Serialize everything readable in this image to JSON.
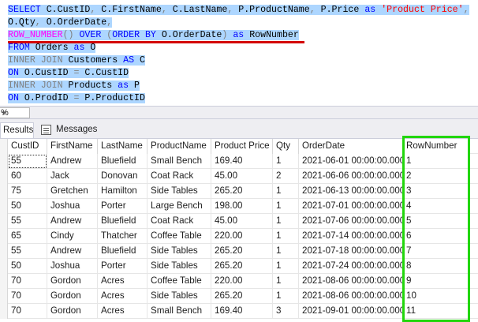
{
  "editor": {
    "lines": [
      {
        "segments": [
          {
            "t": "SELECT",
            "c": "kw"
          },
          {
            "t": " C.CustID",
            "c": "id"
          },
          {
            "t": ",",
            "c": "op"
          },
          {
            "t": " C.FirstName",
            "c": "id"
          },
          {
            "t": ",",
            "c": "op"
          },
          {
            "t": " C.LastName",
            "c": "id"
          },
          {
            "t": ",",
            "c": "op"
          },
          {
            "t": " P.ProductName",
            "c": "id"
          },
          {
            "t": ",",
            "c": "op"
          },
          {
            "t": " P.Price ",
            "c": "id"
          },
          {
            "t": "as",
            "c": "kw"
          },
          {
            "t": " ",
            "c": "id"
          },
          {
            "t": "'Product Price'",
            "c": "str"
          },
          {
            "t": ",",
            "c": "op"
          }
        ]
      },
      {
        "segments": [
          {
            "t": "O.Qty",
            "c": "id"
          },
          {
            "t": ",",
            "c": "op"
          },
          {
            "t": " O.OrderDate",
            "c": "id"
          },
          {
            "t": ",",
            "c": "op"
          }
        ]
      },
      {
        "segments": [
          {
            "t": "ROW_NUMBER",
            "c": "fn"
          },
          {
            "t": "() ",
            "c": "op"
          },
          {
            "t": "OVER",
            "c": "kw"
          },
          {
            "t": " ",
            "c": "id"
          },
          {
            "t": "(",
            "c": "op"
          },
          {
            "t": "ORDER BY",
            "c": "kw"
          },
          {
            "t": " O.OrderDate",
            "c": "id"
          },
          {
            "t": ")",
            "c": "op"
          },
          {
            "t": " ",
            "c": "id"
          },
          {
            "t": "as",
            "c": "kw"
          },
          {
            "t": " RowNumber",
            "c": "id"
          }
        ]
      },
      {
        "segments": [
          {
            "t": "FROM",
            "c": "kw"
          },
          {
            "t": " Orders ",
            "c": "id"
          },
          {
            "t": "as",
            "c": "kw"
          },
          {
            "t": " O",
            "c": "id"
          }
        ]
      },
      {
        "segments": [
          {
            "t": "INNER JOIN",
            "c": "op"
          },
          {
            "t": " Customers ",
            "c": "id"
          },
          {
            "t": "AS",
            "c": "kw"
          },
          {
            "t": " C",
            "c": "id"
          }
        ]
      },
      {
        "segments": [
          {
            "t": "ON",
            "c": "kw"
          },
          {
            "t": " O.CustID ",
            "c": "id"
          },
          {
            "t": "=",
            "c": "op"
          },
          {
            "t": " C.CustID",
            "c": "id"
          }
        ]
      },
      {
        "segments": [
          {
            "t": "INNER JOIN",
            "c": "op"
          },
          {
            "t": " Products ",
            "c": "id"
          },
          {
            "t": "as",
            "c": "kw"
          },
          {
            "t": " P",
            "c": "id"
          }
        ]
      },
      {
        "segments": [
          {
            "t": "ON",
            "c": "kw"
          },
          {
            "t": " O.ProdID ",
            "c": "id"
          },
          {
            "t": "=",
            "c": "op"
          },
          {
            "t": " P.ProductID",
            "c": "id"
          }
        ]
      }
    ]
  },
  "zoom": {
    "value": "%"
  },
  "tabs": {
    "results": "Results",
    "messages": "Messages"
  },
  "grid": {
    "columns": [
      "CustID",
      "FirstName",
      "LastName",
      "ProductName",
      "Product Price",
      "Qty",
      "OrderDate",
      "RowNumber"
    ],
    "rows": [
      [
        "55",
        "Andrew",
        "Bluefield",
        "Small Bench",
        "169.40",
        "1",
        "2021-06-01 00:00:00.000",
        "1"
      ],
      [
        "60",
        "Jack",
        "Donovan",
        "Coat Rack",
        "45.00",
        "2",
        "2021-06-06 00:00:00.000",
        "2"
      ],
      [
        "75",
        "Gretchen",
        "Hamilton",
        "Side Tables",
        "265.20",
        "1",
        "2021-06-13 00:00:00.000",
        "3"
      ],
      [
        "50",
        "Joshua",
        "Porter",
        "Large Bench",
        "198.00",
        "1",
        "2021-07-01 00:00:00.000",
        "4"
      ],
      [
        "55",
        "Andrew",
        "Bluefield",
        "Coat Rack",
        "45.00",
        "1",
        "2021-07-06 00:00:00.000",
        "5"
      ],
      [
        "65",
        "Cindy",
        "Thatcher",
        "Coffee Table",
        "220.00",
        "1",
        "2021-07-14 00:00:00.000",
        "6"
      ],
      [
        "55",
        "Andrew",
        "Bluefield",
        "Side Tables",
        "265.20",
        "1",
        "2021-07-18 00:00:00.000",
        "7"
      ],
      [
        "50",
        "Joshua",
        "Porter",
        "Side Tables",
        "265.20",
        "1",
        "2021-07-24 00:00:00.000",
        "8"
      ],
      [
        "70",
        "Gordon",
        "Acres",
        "Coffee Table",
        "220.00",
        "1",
        "2021-08-06 00:00:00.000",
        "9"
      ],
      [
        "70",
        "Gordon",
        "Acres",
        "Side Tables",
        "265.20",
        "1",
        "2021-08-06 00:00:00.000",
        "10"
      ],
      [
        "70",
        "Gordon",
        "Acres",
        "Small Bench",
        "169.40",
        "3",
        "2021-09-01 00:00:00.000",
        "11"
      ]
    ]
  },
  "colors": {
    "selection": "#add6ff",
    "keyword": "#0000ff",
    "function": "#ff00ff",
    "string": "#ff0000",
    "operator": "#808080",
    "underline": "#d40000",
    "highlight_box": "#22d60c"
  }
}
